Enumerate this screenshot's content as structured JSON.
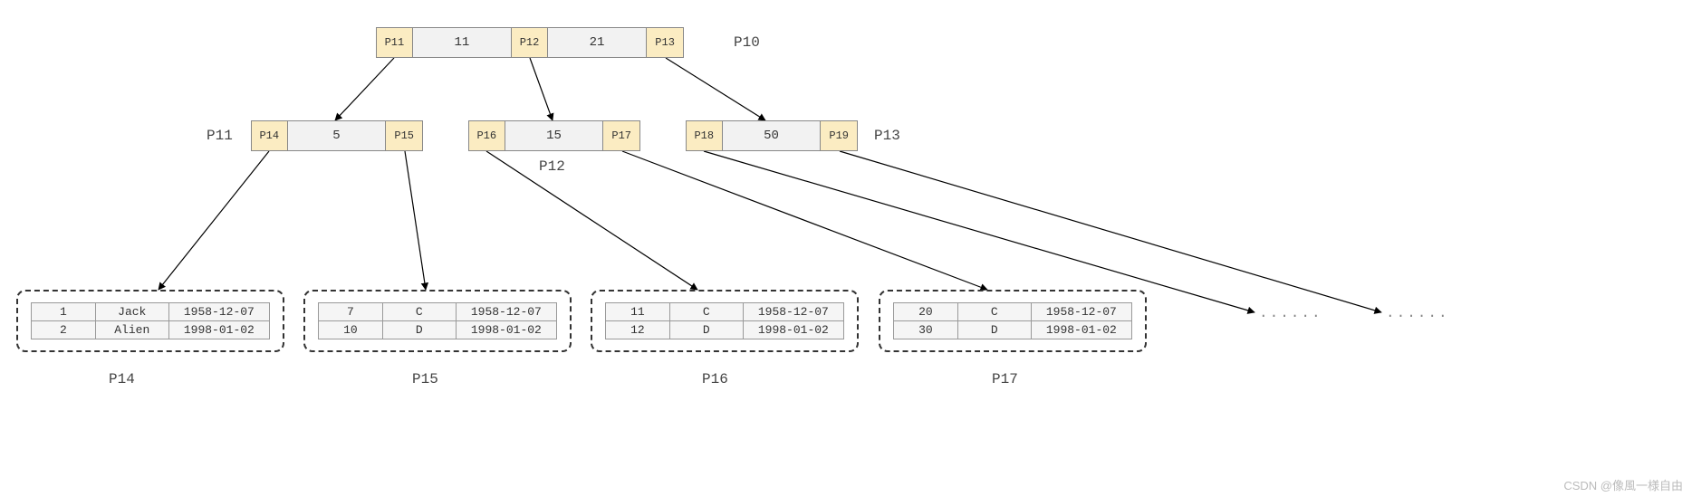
{
  "root": {
    "label": "P10",
    "ptrs": [
      "P11",
      "P12",
      "P13"
    ],
    "keys": [
      "11",
      "21"
    ]
  },
  "mid": {
    "left": {
      "label": "P11",
      "ptrs": [
        "P14",
        "P15"
      ],
      "key": "5"
    },
    "center": {
      "label": "P12",
      "ptrs": [
        "P16",
        "P17"
      ],
      "key": "15"
    },
    "right": {
      "label": "P13",
      "ptrs": [
        "P18",
        "P19"
      ],
      "key": "50"
    }
  },
  "leaves": {
    "p14": {
      "label": "P14",
      "rows": [
        {
          "c1": "1",
          "c2": "Jack",
          "c3": "1958-12-07"
        },
        {
          "c1": "2",
          "c2": "Alien",
          "c3": "1998-01-02"
        }
      ]
    },
    "p15": {
      "label": "P15",
      "rows": [
        {
          "c1": "7",
          "c2": "C",
          "c3": "1958-12-07"
        },
        {
          "c1": "10",
          "c2": "D",
          "c3": "1998-01-02"
        }
      ]
    },
    "p16": {
      "label": "P16",
      "rows": [
        {
          "c1": "11",
          "c2": "C",
          "c3": "1958-12-07"
        },
        {
          "c1": "12",
          "c2": "D",
          "c3": "1998-01-02"
        }
      ]
    },
    "p17": {
      "label": "P17",
      "rows": [
        {
          "c1": "20",
          "c2": "C",
          "c3": "1958-12-07"
        },
        {
          "c1": "30",
          "c2": "D",
          "c3": "1998-01-02"
        }
      ]
    }
  },
  "dots": "······",
  "watermark": "CSDN @像風一様自由"
}
